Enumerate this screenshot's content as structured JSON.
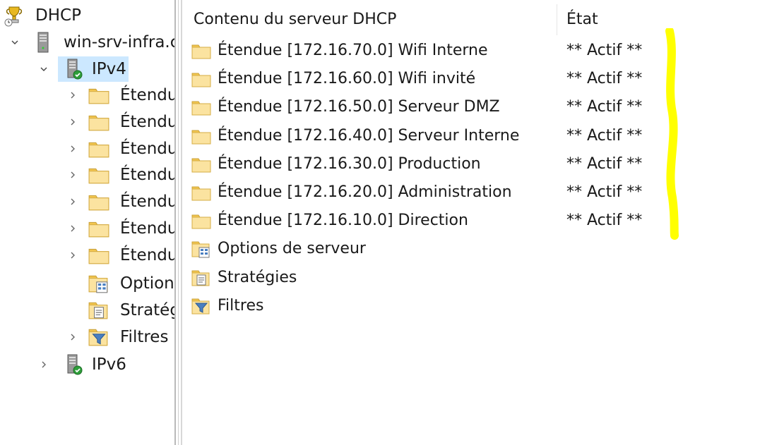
{
  "tree": {
    "root_label": "DHCP",
    "server_label": "win-srv-infra.c",
    "ipv4_label": "IPv4",
    "ipv4_children": [
      {
        "label": "Étendu",
        "icon": "folder-icon"
      },
      {
        "label": "Étendu",
        "icon": "folder-icon"
      },
      {
        "label": "Étendu",
        "icon": "folder-icon"
      },
      {
        "label": "Étendu",
        "icon": "folder-icon"
      },
      {
        "label": "Étendu",
        "icon": "folder-icon"
      },
      {
        "label": "Étendu",
        "icon": "folder-icon"
      },
      {
        "label": "Étendu",
        "icon": "folder-icon"
      },
      {
        "label": "Option",
        "icon": "server-options-icon"
      },
      {
        "label": "Stratég",
        "icon": "policies-icon"
      },
      {
        "label": "Filtres",
        "icon": "filter-icon"
      }
    ],
    "ipv6_label": "IPv6"
  },
  "list": {
    "col_content": "Contenu du serveur DHCP",
    "col_state": "État",
    "rows": [
      {
        "name": "Étendue [172.16.70.0] Wifi Interne",
        "state": "** Actif **",
        "icon": "folder-icon"
      },
      {
        "name": "Étendue [172.16.60.0] Wifi invité",
        "state": "** Actif **",
        "icon": "folder-icon"
      },
      {
        "name": "Étendue [172.16.50.0] Serveur DMZ",
        "state": "** Actif **",
        "icon": "folder-icon"
      },
      {
        "name": "Étendue [172.16.40.0] Serveur Interne",
        "state": "** Actif **",
        "icon": "folder-icon"
      },
      {
        "name": "Étendue [172.16.30.0] Production",
        "state": "** Actif **",
        "icon": "folder-icon"
      },
      {
        "name": "Étendue [172.16.20.0] Administration",
        "state": "** Actif **",
        "icon": "folder-icon"
      },
      {
        "name": "Étendue [172.16.10.0] Direction",
        "state": "** Actif **",
        "icon": "folder-icon"
      },
      {
        "name": "Options de serveur",
        "state": "",
        "icon": "server-options-icon"
      },
      {
        "name": "Stratégies",
        "state": "",
        "icon": "policies-icon"
      },
      {
        "name": "Filtres",
        "state": "",
        "icon": "filter-icon"
      }
    ]
  },
  "colors": {
    "selection": "#cce8ff",
    "highlight": "#ffff00",
    "folder": "#f7d677"
  }
}
